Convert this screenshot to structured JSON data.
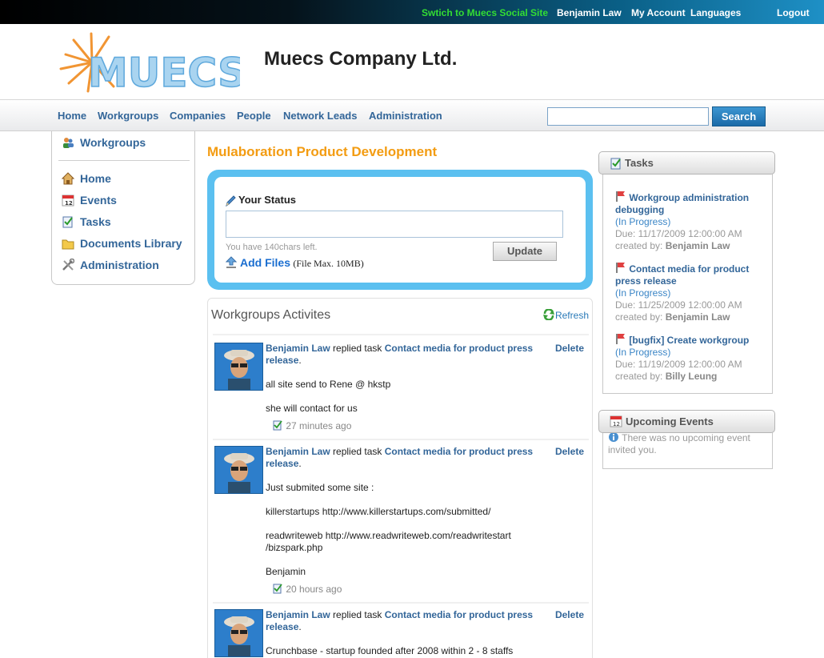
{
  "topbar": {
    "social_link": "Swtich to Muecs Social Site",
    "user": "Benjamin Law",
    "my_account": "My Account",
    "languages": "Languages",
    "logout": "Logout"
  },
  "header": {
    "logo_text": "MUECS",
    "company_name": "Muecs Company Ltd."
  },
  "nav": {
    "items": [
      "Home",
      "Workgroups",
      "Companies",
      "People",
      "Network Leads",
      "Administration"
    ],
    "search_value": "",
    "search_button": "Search"
  },
  "sidebar": {
    "title": "Workgroups",
    "items": [
      {
        "label": "Home",
        "icon": "home-icon"
      },
      {
        "label": "Events",
        "icon": "calendar-icon"
      },
      {
        "label": "Tasks",
        "icon": "tasks-icon"
      },
      {
        "label": "Documents Library",
        "icon": "folder-icon"
      },
      {
        "label": "Administration",
        "icon": "tools-icon"
      }
    ]
  },
  "main": {
    "title": "Mulaboration Product Development",
    "status": {
      "title": "Your Status",
      "value": "",
      "chars_left": "You have 140chars left.",
      "update_button": "Update",
      "add_files": "Add Files",
      "file_max": "(File Max. 10MB)"
    },
    "activities": {
      "title": "Workgroups Activites",
      "refresh": "Refresh",
      "delete_label": "Delete",
      "items": [
        {
          "author": "Benjamin Law",
          "action": " replied task ",
          "task": "Contact media for product press release",
          "lines": [
            "all site send to Rene @ hkstp",
            "",
            "she will contact for us"
          ],
          "time": "27 minutes ago"
        },
        {
          "author": "Benjamin Law",
          "action": " replied task ",
          "task": "Contact media for product press release",
          "lines": [
            "Just submited some site :",
            "",
            "killerstartups http://www.killerstartups.com/submitted/",
            "",
            "readwriteweb http://www.readwriteweb.com/readwritestart /bizspark.php",
            "",
            "Benjamin"
          ],
          "time": "20 hours ago"
        },
        {
          "author": "Benjamin Law",
          "action": " replied task ",
          "task": "Contact media for product press release",
          "lines": [
            "Crunchbase - startup founded after 2008 within 2 - 8 staffs"
          ],
          "time": ""
        }
      ]
    }
  },
  "right": {
    "tasks_title": "Tasks",
    "tasks": [
      {
        "name": "Workgroup administration debugging",
        "status": "(In Progress)",
        "due": "Due: 11/17/2009 12:00:00 AM",
        "created_label": "created by:",
        "created_by": "Benjamin Law"
      },
      {
        "name": "Contact media for product press release",
        "status": "(In Progress)",
        "due": "Due: 11/25/2009 12:00:00 AM",
        "created_label": "created by:",
        "created_by": "Benjamin Law"
      },
      {
        "name": "[bugfix] Create workgroup",
        "status": "(In Progress)",
        "due": "Due: 11/19/2009 12:00:00 AM",
        "created_label": "created by:",
        "created_by": "Billy Leung"
      }
    ],
    "events_title": "Upcoming Events",
    "no_events": "There was no upcoming event invited you."
  },
  "colors": {
    "accent_orange": "#f39c12",
    "link_blue": "#336699",
    "status_frame": "#5bc0f0",
    "social_green": "#33dd33"
  }
}
